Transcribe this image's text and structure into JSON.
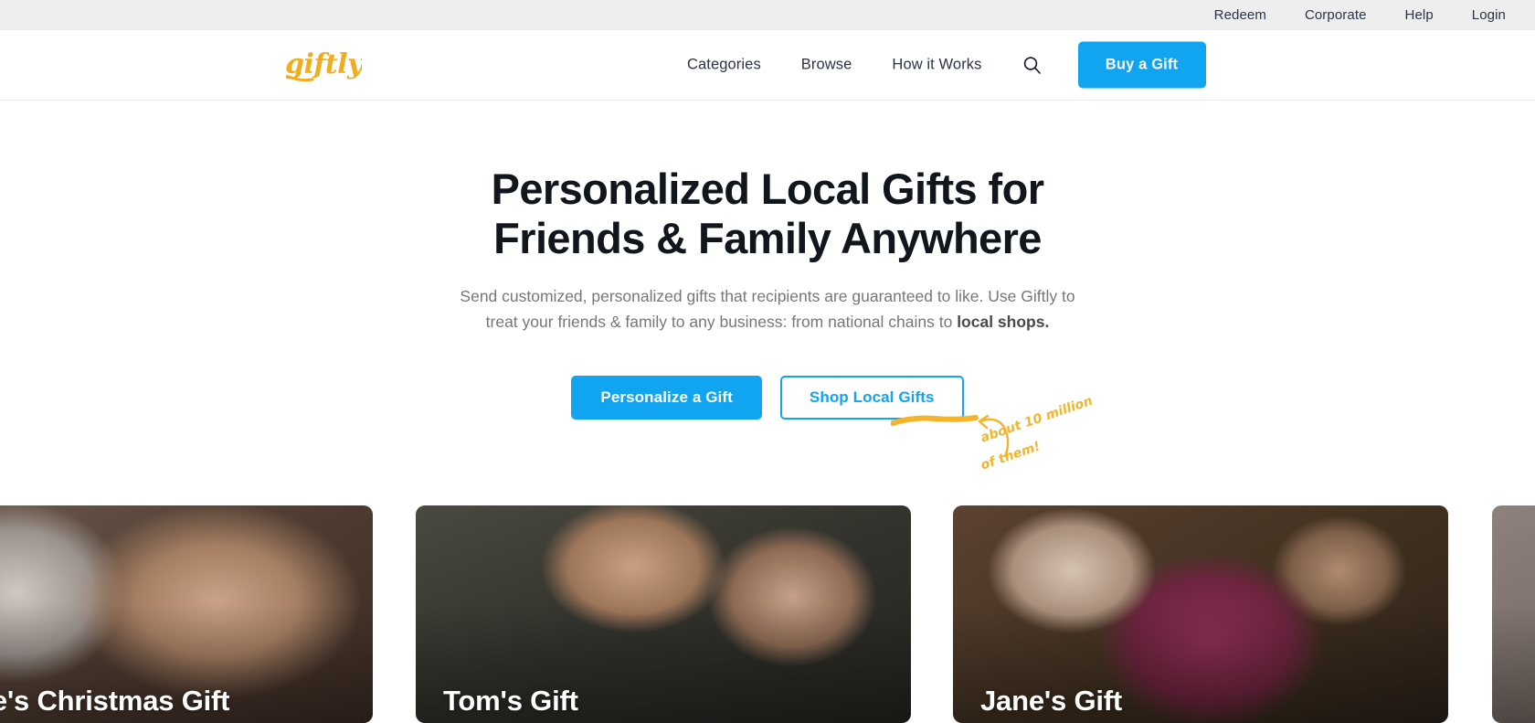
{
  "topbar": {
    "links": [
      {
        "label": "Redeem",
        "name": "topbar-link-redeem"
      },
      {
        "label": "Corporate",
        "name": "topbar-link-corporate"
      },
      {
        "label": "Help",
        "name": "topbar-link-help"
      },
      {
        "label": "Login",
        "name": "topbar-link-login"
      }
    ]
  },
  "header": {
    "logo_text": "giftly",
    "logo_color": "#f0ad22",
    "nav": [
      {
        "label": "Categories"
      },
      {
        "label": "Browse"
      },
      {
        "label": "How it Works"
      }
    ],
    "search_icon": "search-icon",
    "buy_button": "Buy a Gift",
    "accent_color": "#11a4f0"
  },
  "hero": {
    "title_line1": "Personalized Local Gifts for",
    "title_line2": "Friends & Family Anywhere",
    "subtitle_part1": "Send customized, personalized gifts that recipients are guaranteed to like. Use Giftly to treat your friends & family to any business: from national chains to ",
    "subtitle_bold": "local shops.",
    "annotation_line1": "about 10 million",
    "annotation_line2": "of them!",
    "annotation_color": "#f2b52b",
    "cta_primary": "Personalize a Gift",
    "cta_secondary": "Shop Local Gifts"
  },
  "cards": [
    {
      "label": "Jane's Christmas Gift",
      "name": "gift-card-janes-christmas-gift"
    },
    {
      "label": "Tom's Gift",
      "name": "gift-card-toms-gift"
    },
    {
      "label": "Jane's Gift",
      "name": "gift-card-janes-gift"
    },
    {
      "label": "",
      "name": "gift-card-partial"
    }
  ]
}
